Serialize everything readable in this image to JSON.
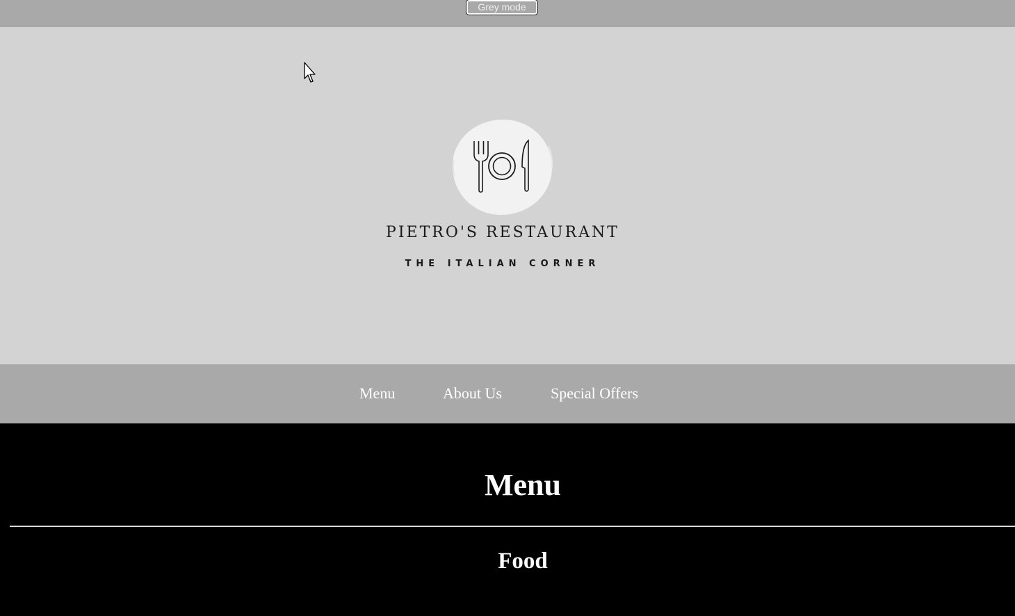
{
  "toolbar": {
    "grey_mode_label": "Grey mode"
  },
  "header": {
    "logo_icon": "plate-fork-knife-icon",
    "restaurant_name": "PIETRO'S RESTAURANT",
    "tagline": "THE ITALIAN CORNER"
  },
  "nav": {
    "items": [
      {
        "label": "Menu"
      },
      {
        "label": "About Us"
      },
      {
        "label": "Special Offers"
      }
    ]
  },
  "main": {
    "section_title": "Menu",
    "subsection_title": "Food"
  },
  "colors": {
    "topbar": "#a9a9a9",
    "hero_bg": "#d3d3d3",
    "nav_bg": "#a9a9a9",
    "content_bg": "#000000",
    "logo_circle": "#f2f2f2",
    "text_dark": "#1a1a1a",
    "text_light": "#ffffff"
  }
}
